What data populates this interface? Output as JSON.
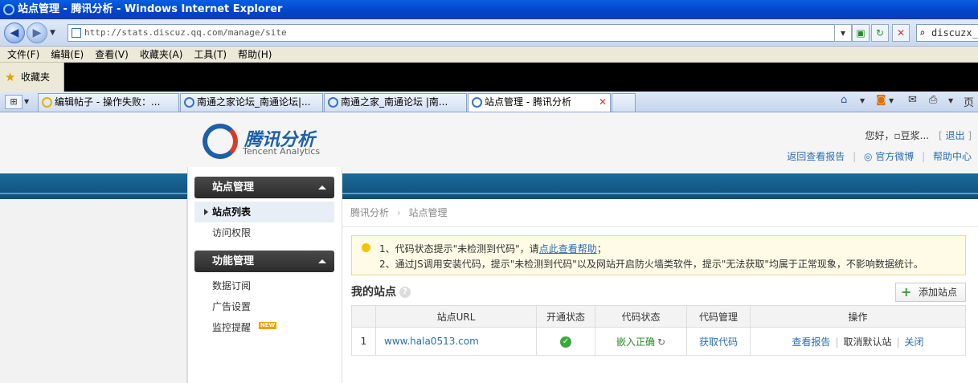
{
  "window": {
    "title": "站点管理 - 腾讯分析 - Windows Internet Explorer"
  },
  "address": {
    "url": "http://stats.discuz.qq.com/manage/site",
    "search": "discuzx_u"
  },
  "menu": [
    "文件(F)",
    "编辑(E)",
    "查看(V)",
    "收藏夹(A)",
    "工具(T)",
    "帮助(H)"
  ],
  "favorites": {
    "label": "收藏夹"
  },
  "tabs": [
    {
      "label": "编辑帖子 - 操作失败：..."
    },
    {
      "label": "南通之家论坛_南通论坛|..."
    },
    {
      "label": "南通之家_南通论坛 |南..."
    },
    {
      "label": "站点管理 - 腾讯分析"
    }
  ],
  "toolbar_right": {
    "page": "页面"
  },
  "header": {
    "logo_cn": "腾讯分析",
    "logo_en": "Tencent Analytics",
    "greeting": "您好，▫豆浆...",
    "logout": "退出",
    "links": [
      "返回查看报告",
      "官方微博",
      "帮助中心"
    ]
  },
  "sidebar": {
    "sec1": "站点管理",
    "sec1_items": [
      "站点列表",
      "访问权限"
    ],
    "sec2": "功能管理",
    "sec2_items": [
      "数据订阅",
      "广告设置",
      "监控提醒"
    ],
    "new_badge": "NEW"
  },
  "breadcrumb": {
    "root": "腾讯分析",
    "sep": "›",
    "current": "站点管理"
  },
  "tip": {
    "line1_pre": "1、代码状态提示\"未检测到代码\"，请",
    "line1_link": "点此查看帮助",
    "line1_post": "；",
    "line2": "2、通过JS调用安装代码，提示\"未检测到代码\"以及网站开启防火墙类软件，提示\"无法获取\"均属于正常现象，不影响数据统计。"
  },
  "sites": {
    "title": "我的站点",
    "add_button": "添加站点",
    "columns": [
      "",
      "站点URL",
      "开通状态",
      "代码状态",
      "代码管理",
      "操作"
    ],
    "rows": [
      {
        "num": "1",
        "url": "www.hala0513.com",
        "status": "✓",
        "code_status": "嵌入正确",
        "code_mgmt": "获取代码",
        "actions": [
          "查看报告",
          "取消默认站",
          "关闭"
        ]
      }
    ]
  }
}
